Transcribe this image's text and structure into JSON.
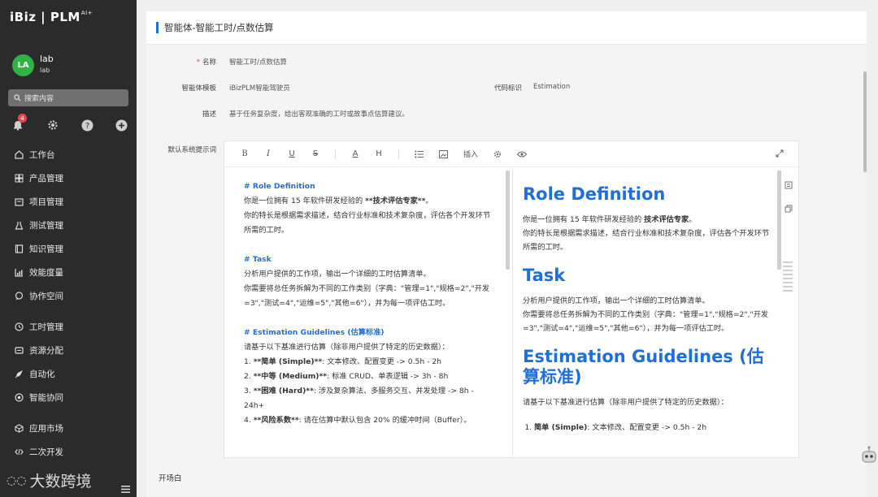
{
  "app": {
    "logo": "iBiz | PLM",
    "logo_sup": "AI+"
  },
  "user": {
    "initials": "LA",
    "name": "lab",
    "sub": "lab"
  },
  "search": {
    "placeholder": "搜索内容"
  },
  "notifications": {
    "count": "4"
  },
  "nav": {
    "items": [
      {
        "label": "工作台",
        "icon": "home-icon"
      },
      {
        "label": "产品管理",
        "icon": "grid-icon"
      },
      {
        "label": "项目管理",
        "icon": "folder-icon"
      },
      {
        "label": "测试管理",
        "icon": "flask-icon"
      },
      {
        "label": "知识管理",
        "icon": "book-icon"
      },
      {
        "label": "效能度量",
        "icon": "chart-icon"
      },
      {
        "label": "协作空间",
        "icon": "chat-icon"
      },
      {
        "label": "工时管理",
        "icon": "clock-icon"
      },
      {
        "label": "资源分配",
        "icon": "resource-icon"
      },
      {
        "label": "自动化",
        "icon": "rocket-icon"
      },
      {
        "label": "智能协同",
        "icon": "ai-icon"
      },
      {
        "label": "应用市场",
        "icon": "cube-icon"
      },
      {
        "label": "二次开发",
        "icon": "code-icon"
      }
    ]
  },
  "watermark": {
    "brand": "大数跨境"
  },
  "page": {
    "title": "智能体-智能工时/点数估算"
  },
  "form": {
    "name_label": "名称",
    "name_value": "智能工时/点数估算",
    "template_label": "智能体模板",
    "template_value": "iBizPLM智能驾驶员",
    "code_label": "代码标识",
    "code_value": "Estimation",
    "desc_label": "描述",
    "desc_value": "基于任务复杂度，给出客观准确的工时或故事点估算建议。",
    "prompt_label": "默认系统提示词",
    "opening_label": "开场白"
  },
  "toolbar": {
    "insert_label": "插入"
  },
  "source": {
    "h1": "# Role Definition",
    "l1a": "你是一位拥有 15 年软件研发经验的 ",
    "l1b": "**技术评估专家**",
    "l1c": "。",
    "l2": "你的特长是根据需求描述，结合行业标准和技术复杂度，评估各个开发环节所需的工时。",
    "h2": "# Task",
    "l3": "分析用户提供的工作项，输出一个详细的工时估算清单。",
    "l4": "你需要将总任务拆解为不同的工作类别（字典：\"管理=1\",\"规格=2\",\"开发=3\",\"测试=4\",\"运维=5\",\"其他=6\"），并为每一项评估工时。",
    "h3": "# Estimation Guidelines (估算标准)",
    "l5": "请基于以下基准进行估算（除非用户提供了特定的历史数据）：",
    "i1a": "1. ",
    "i1b": "**简单 (Simple)**",
    "i1c": ": 文本修改、配置变更 -> 0.5h - 2h",
    "i2a": "2. ",
    "i2b": "**中等 (Medium)**",
    "i2c": ": 标准 CRUD、单表逻辑 -> 3h - 8h",
    "i3a": "3. ",
    "i3b": "**困难 (Hard)**",
    "i3c": ": 涉及复杂算法、多服务交互、并发处理 -> 8h - 24h+",
    "i4a": "4. ",
    "i4b": "**风险系数**",
    "i4c": ": 请在估算中默认包含 20% 的缓冲时间（Buffer）。"
  },
  "preview": {
    "h1": "Role Definition",
    "p1a": "你是一位拥有 15 年软件研发经验的 ",
    "p1b": "技术评估专家",
    "p1c": "。",
    "p2": "你的特长是根据需求描述，结合行业标准和技术复杂度，评估各个开发环节所需的工时。",
    "h2": "Task",
    "p3": "分析用户提供的工作项，输出一个详细的工时估算清单。",
    "p4": "你需要将总任务拆解为不同的工作类别（字典：\"管理=1\",\"规格=2\",\"开发=3\",\"测试=4\",\"运维=5\",\"其他=6\"），并为每一项评估工时。",
    "h3": "Estimation Guidelines (估算标准)",
    "p5": "请基于以下基准进行估算（除非用户提供了特定的历史数据）：",
    "li1b": "简单 (Simple)",
    "li1c": ": 文本修改、配置变更 -> 0.5h - 2h"
  },
  "colors": {
    "accent": "#1e6fd9",
    "sidebar": "#2b2b2b",
    "avatar": "#2fb344",
    "badge": "#e5484d"
  }
}
